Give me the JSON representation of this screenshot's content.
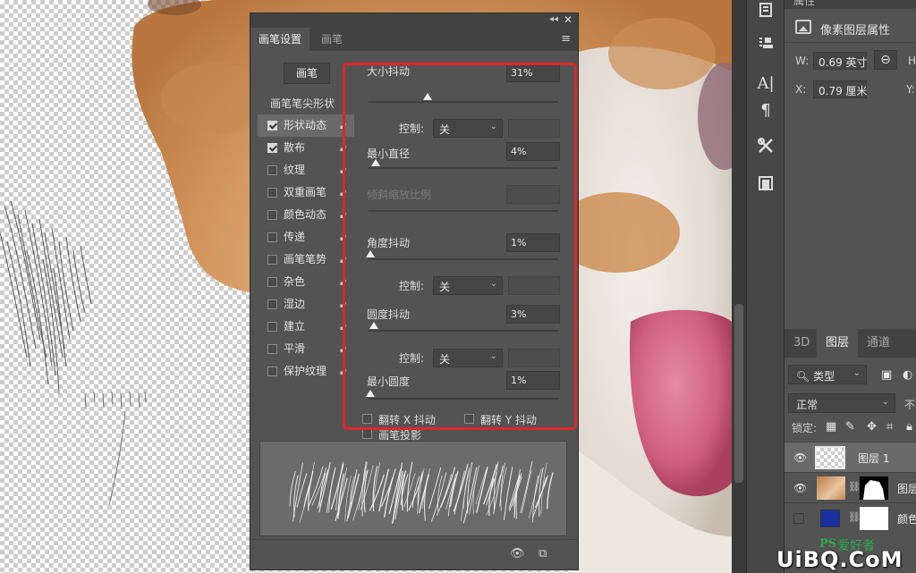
{
  "brush_panel": {
    "tabs": [
      "画笔设置",
      "画笔"
    ],
    "brush_button": "画笔",
    "tip_shape": "画笔笔尖形状",
    "options": [
      {
        "label": "形状动态",
        "checked": true
      },
      {
        "label": "散布",
        "checked": true
      },
      {
        "label": "纹理",
        "checked": false
      },
      {
        "label": "双重画笔",
        "checked": false
      },
      {
        "label": "颜色动态",
        "checked": false
      },
      {
        "label": "传递",
        "checked": false
      },
      {
        "label": "画笔笔势",
        "checked": false
      },
      {
        "label": "杂色",
        "checked": false
      },
      {
        "label": "湿边",
        "checked": false
      },
      {
        "label": "建立",
        "checked": false
      },
      {
        "label": "平滑",
        "checked": false
      },
      {
        "label": "保护纹理",
        "checked": false
      }
    ],
    "settings": {
      "size_jitter": {
        "label": "大小抖动",
        "value": "31%",
        "level": 0.31
      },
      "control_1": {
        "label": "控制:",
        "value": "关"
      },
      "min_diameter": {
        "label": "最小直径",
        "value": "4%",
        "level": 0.04
      },
      "tilt_scale": {
        "label": "倾斜缩放比例"
      },
      "angle_jitter": {
        "label": "角度抖动",
        "value": "1%",
        "level": 0.01
      },
      "control_2": {
        "label": "控制:",
        "value": "关"
      },
      "roundness_jitter": {
        "label": "圆度抖动",
        "value": "3%",
        "level": 0.03
      },
      "control_3": {
        "label": "控制:",
        "value": "关"
      },
      "min_roundness": {
        "label": "最小圆度",
        "value": "1%",
        "level": 0.01
      }
    },
    "flip_x": "翻转 X 抖动",
    "flip_y": "翻转 Y 抖动",
    "brush_projection": "画笔投影"
  },
  "properties": {
    "tab": "属性",
    "title": "像素图层属性",
    "w_label": "W:",
    "w_value": "0.69 英寸",
    "h_label": "H:",
    "x_label": "X:",
    "x_value": "0.79 厘米",
    "y_label": "Y:"
  },
  "layers_panel": {
    "tabs": [
      "3D",
      "图层",
      "通道"
    ],
    "filter_type": "类型",
    "blend_mode": "正常",
    "opacity_label": "不",
    "lock_label": "锁定:",
    "layers": [
      {
        "name": "图层 1",
        "visible": true,
        "selected": true
      },
      {
        "name": "图层",
        "visible": true,
        "selected": false
      },
      {
        "name": "颜色",
        "visible": false,
        "selected": false
      }
    ]
  },
  "watermark": {
    "ps": "PS",
    "site": "爱好者",
    "url": "UiBQ.CoM"
  },
  "colors": {
    "highlight": "#e0252a",
    "panel": "#535353",
    "fill_layer": "#1a2fa0"
  }
}
